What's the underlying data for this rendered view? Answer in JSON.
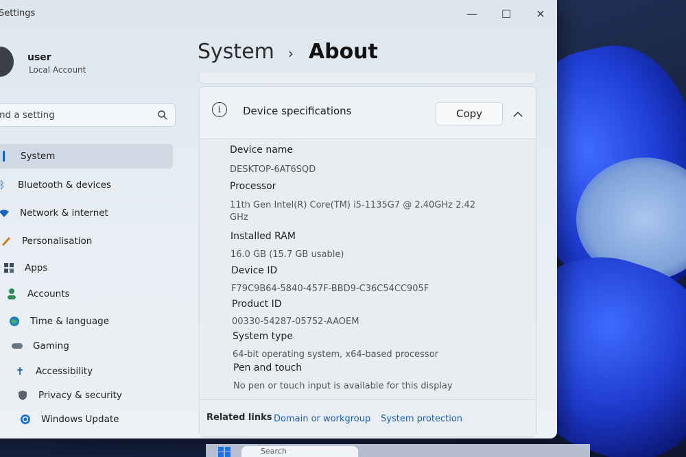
{
  "app": {
    "title": "Settings"
  },
  "window_controls": {
    "minimize": "—",
    "maximize": "☐",
    "close": "✕"
  },
  "user": {
    "name": "user",
    "account_type": "Local Account"
  },
  "search": {
    "placeholder": "nd a setting"
  },
  "sidebar": {
    "items": [
      {
        "label": "System",
        "icon": "system-icon",
        "active": true
      },
      {
        "label": "Bluetooth & devices",
        "icon": "bluetooth-icon"
      },
      {
        "label": "Network & internet",
        "icon": "wifi-icon"
      },
      {
        "label": "Personalisation",
        "icon": "brush-icon"
      },
      {
        "label": "Apps",
        "icon": "apps-icon"
      },
      {
        "label": "Accounts",
        "icon": "person-icon"
      },
      {
        "label": "Time & language",
        "icon": "globe-icon"
      },
      {
        "label": "Gaming",
        "icon": "gamepad-icon"
      },
      {
        "label": "Accessibility",
        "icon": "accessibility-icon"
      },
      {
        "label": "Privacy & security",
        "icon": "shield-icon"
      },
      {
        "label": "Windows Update",
        "icon": "update-icon"
      }
    ]
  },
  "breadcrumb": {
    "root": "System",
    "separator": "›",
    "current": "About"
  },
  "device_specs": {
    "title": "Device specifications",
    "copy_label": "Copy",
    "rows": [
      {
        "label": "Device name",
        "value": "DESKTOP-6AT6SQD"
      },
      {
        "label": "Processor",
        "value": "11th Gen Intel(R) Core(TM) i5-1135G7 @ 2.40GHz   2.42 GHz"
      },
      {
        "label": "Installed RAM",
        "value": "16.0 GB (15.7 GB usable)"
      },
      {
        "label": "Device ID",
        "value": "F79C9B64-5840-457F-BBD9-C36C54CC905F"
      },
      {
        "label": "Product ID",
        "value": "00330-54287-05752-AAOEM"
      },
      {
        "label": "System type",
        "value": "64-bit operating system, x64-based processor"
      },
      {
        "label": "Pen and touch",
        "value": "No pen or touch input is available for this display"
      }
    ]
  },
  "related_links": {
    "title": "Related links",
    "links": [
      "Domain or workgroup",
      "System protection"
    ]
  },
  "taskbar": {
    "search_label": "Search"
  },
  "colors": {
    "accent": "#0067c0",
    "link": "#1a5fb4"
  }
}
